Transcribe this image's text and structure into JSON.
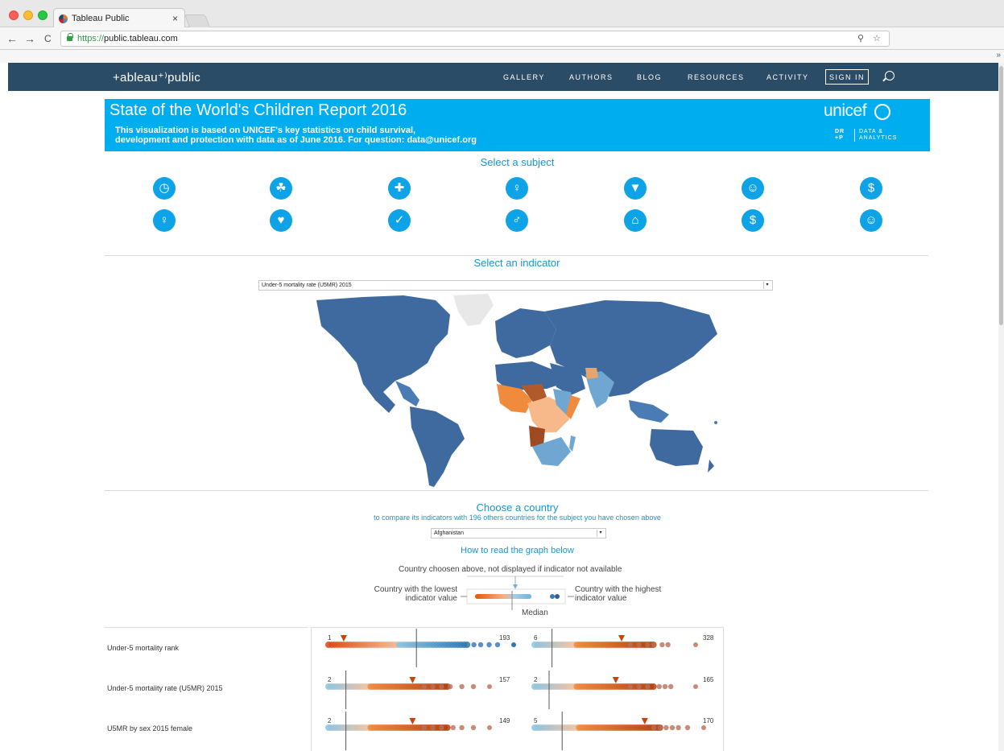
{
  "browser": {
    "tab_title": "Tableau Public",
    "tab_close": "×",
    "url_scheme": "https://",
    "url_host": "public.tableau.com",
    "toolbar_icons": "⚲ ☆",
    "bookmarks_overflow": "»",
    "nav_back": "←",
    "nav_forward": "→",
    "nav_reload": "C"
  },
  "tableau": {
    "logo": "+ableau⁺⁾public",
    "nav": [
      "GALLERY",
      "AUTHORS",
      "BLOG",
      "RESOURCES",
      "ACTIVITY"
    ],
    "signin": "SIGN IN"
  },
  "banner": {
    "title": "State of the World's Children Report 2016",
    "subtitle_line1": "This visualization is based on UNICEF's key statistics on child survival,",
    "subtitle_line2": "development and protection with data as of June 2016. For question: data@unicef.org",
    "brand": "unicef",
    "drp_left": "DR\n+P",
    "drp_right": "DATA &\nANALYTICS"
  },
  "subject": {
    "title": "Select a subject",
    "icons_row1": [
      "clock-icon",
      "apple-icon",
      "medical-kit-icon",
      "ribbon-icon",
      "graduation-cap-icon",
      "people-group-icon",
      "money-icon"
    ],
    "icons_row2": [
      "female-icon",
      "family-care-icon",
      "check-clock-icon",
      "boy-girl-icon",
      "house-icon",
      "savings-house-icon",
      "baby-icon"
    ],
    "glyphs_row1": [
      "◷",
      "☘",
      "✚",
      "♀",
      "▼",
      "☺",
      "$"
    ],
    "glyphs_row2": [
      "♀",
      "♥",
      "✓",
      "♂",
      "⌂",
      "$",
      "☺"
    ]
  },
  "indicator": {
    "title": "Select an indicator",
    "selected": "Under-5 mortality rate (U5MR) 2015",
    "arrow": "▾"
  },
  "country": {
    "title": "Choose a country",
    "subtitle": "to compare its indicators with 196 others countries for the subject you have chosen above",
    "selected": "Afghanistan",
    "arrow": "▾"
  },
  "legend": {
    "title": "How to read the graph below",
    "top_note": "Country choosen above, not displayed if indicator not available",
    "lowest_line1": "Country with the lowest",
    "lowest_line2": "indicator value",
    "highest_line1": "Country with the highest",
    "highest_line2": "indicator value",
    "median": "Median"
  },
  "rows": [
    {
      "label": "Under-5 mortality rank",
      "left_min": "1",
      "left_max": "193",
      "right_min": "6",
      "right_max": "328"
    },
    {
      "label": "Under-5 mortality rate (U5MR) 2015",
      "left_min": "2",
      "left_max": "157",
      "right_min": "2",
      "right_max": "165"
    },
    {
      "label": "U5MR by sex 2015 female",
      "left_min": "2",
      "left_max": "149",
      "right_min": "5",
      "right_max": "170"
    }
  ],
  "colors": {
    "header_navy": "#2b4c66",
    "unicef_blue": "#00aeef",
    "accent_blue": "#1696d2",
    "map_dark_blue": "#3f6a9f",
    "map_orange": "#f08a3c",
    "map_brown": "#b05a2b"
  }
}
